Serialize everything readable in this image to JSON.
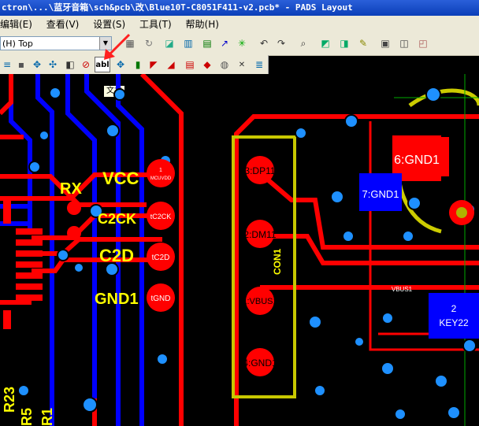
{
  "window": {
    "title": "ctron\\...\\蓝牙音箱\\sch&pcb\\改\\Blue10T-C8051F411-v2.pcb* - PADS Layout"
  },
  "menu": [
    "编辑(E)",
    "查看(V)",
    "设置(S)",
    "工具(T)",
    "帮助(H)"
  ],
  "toolbar": {
    "layer_value": "(H) Top",
    "tooltip": "文本",
    "text_button_label": "abl"
  },
  "board": {
    "silk": [
      "VCC",
      "C2CK",
      "C2D",
      "GND1",
      "RX",
      "R23",
      "R5",
      "R1"
    ],
    "pads": [
      "1:DP11",
      "MCUVDD",
      "C2CK",
      "C2D",
      "GND",
      "3:DP11",
      "2:DM11",
      "1:VBUS1",
      "4:GND1"
    ],
    "parts": [
      "6:GND1",
      "7:GND1",
      "2",
      "KEY22",
      "VBUS1",
      "CON1"
    ],
    "net_labels": [
      "1",
      "MCUVDD",
      "tC2CK",
      "tC2D",
      "tGND"
    ]
  },
  "colors": {
    "title": "#0b3fb8",
    "ui": "#ece9d8",
    "trace_red": "#ff0000",
    "trace_blue": "#0000ff",
    "silk_yellow": "#ffff00",
    "via": "#1e90ff"
  }
}
